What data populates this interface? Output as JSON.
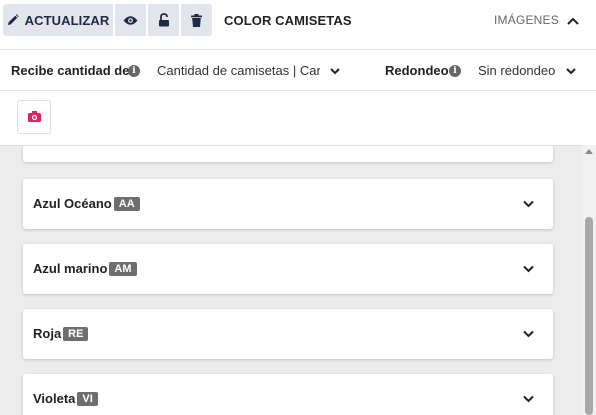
{
  "toolbar": {
    "update_label": "ACTUALIZAR",
    "update_icon": "pencil-icon",
    "view_icon": "eye-icon",
    "lock_icon": "unlock-icon",
    "delete_icon": "trash-icon",
    "title": "COLOR CAMISETAS",
    "images_label": "IMÁGENES",
    "collapse_icon": "chevron-up-icon"
  },
  "settings": {
    "quantity_label": "Recibe cantidad de",
    "quantity_value": "Cantidad de camisetas | Can",
    "rounding_label": "Redondeo",
    "rounding_value": "Sin redondeo"
  },
  "image_row": {
    "camera_icon": "camera-icon",
    "camera_color": "#e0245e"
  },
  "colors": {
    "button_bg": "#e2e6ec",
    "badge_bg": "#6e6e6e",
    "panel_bg": "#ececec"
  },
  "options": [
    {
      "name": "Azul Océano",
      "code": "AA"
    },
    {
      "name": "Azul marino",
      "code": "AM"
    },
    {
      "name": "Roja",
      "code": "RE"
    },
    {
      "name": "Violeta",
      "code": "VI"
    }
  ]
}
